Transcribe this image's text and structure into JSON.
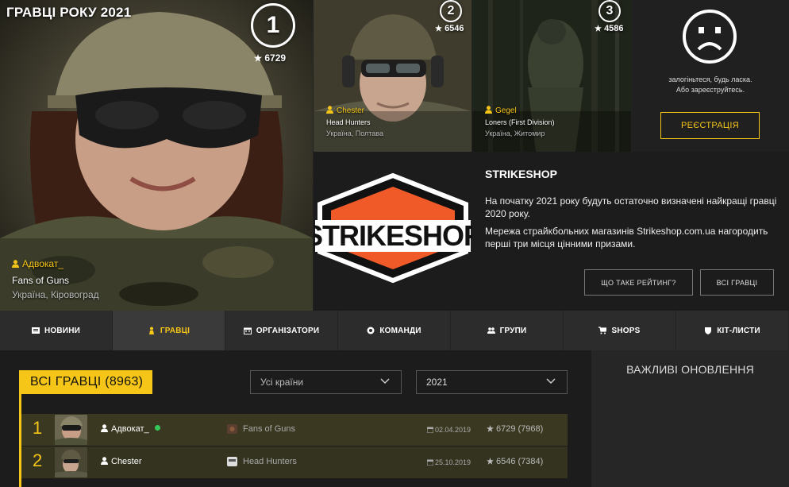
{
  "hero": {
    "title": "ГРАВЦІ РОКУ 2021",
    "players": [
      {
        "rank": "1",
        "score": "6729",
        "name": "Адвокат_",
        "team": "Fans of Guns",
        "location": "Україна, Кіровоград"
      },
      {
        "rank": "2",
        "score": "6546",
        "name": "Chester",
        "team": "Head Hunters",
        "location": "Україна, Полтава"
      },
      {
        "rank": "3",
        "score": "4586",
        "name": "Gegel",
        "team": "Loners (First Division)",
        "location": "Україна, Житомир"
      }
    ]
  },
  "login": {
    "line1": "залогіньтеся, будь ласка.",
    "line2": "Або зареєструйтесь.",
    "register_label": "РЕЄСТРАЦІЯ"
  },
  "shop": {
    "logo_text": "STRIKESHOP",
    "title": "STRIKESHOP",
    "para1": "На початку 2021 року будуть остаточно визначені найкращі гравці 2020 року.",
    "para2": "Мережа страйкбольних магазинів Strikeshop.com.ua нагородить перші три місця цінними призами.",
    "rating_btn": "ЩО ТАКЕ РЕЙТИНГ?",
    "all_players_btn": "ВСІ ГРАВЦІ"
  },
  "nav": [
    {
      "label": "НОВИНИ",
      "icon": "newspaper-icon"
    },
    {
      "label": "ГРАВЦІ",
      "icon": "soldier-icon"
    },
    {
      "label": "ОРГАНІЗАТОРИ",
      "icon": "calendar-icon"
    },
    {
      "label": "КОМАНДИ",
      "icon": "emblem-icon"
    },
    {
      "label": "ГРУПИ",
      "icon": "group-icon"
    },
    {
      "label": "SHOPS",
      "icon": "cart-icon"
    },
    {
      "label": "КІТ-ЛИСТИ",
      "icon": "shield-icon"
    }
  ],
  "main": {
    "all_players_title": "ВСІ ГРАВЦІ (8963)",
    "country_select": "Усі країни",
    "year_select": "2021",
    "rows": [
      {
        "rank": "1",
        "name": "Адвокат_",
        "team": "Fans of Guns",
        "date": "02.04.2019",
        "score": "6729 (7968)"
      },
      {
        "rank": "2",
        "name": "Chester",
        "team": "Head Hunters",
        "date": "25.10.2019",
        "score": "6546 (7384)"
      }
    ]
  },
  "aside": {
    "title": "ВАЖЛИВІ ОНОВЛЕННЯ"
  },
  "colors": {
    "accent": "#f5c518",
    "row_bg": "#3a3820",
    "nav_bg": "#2c2c2c",
    "logo_orange": "#f05a28"
  }
}
